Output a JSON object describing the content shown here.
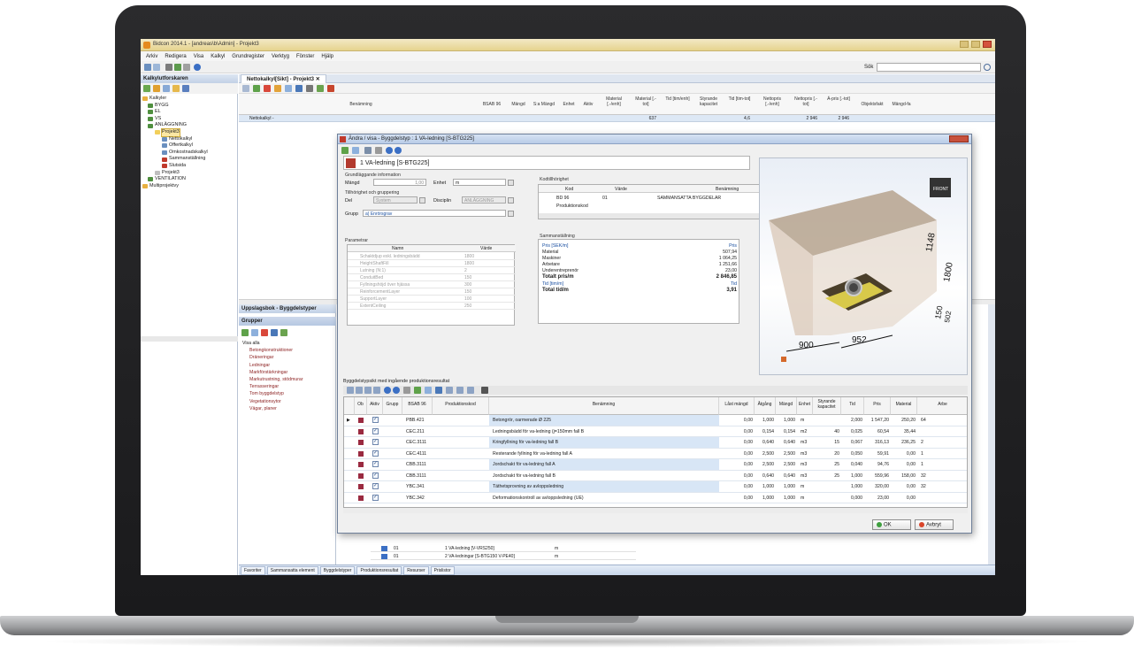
{
  "app": {
    "title": "Bidcon 2014.1 - [andreas\\b\\Admin] - Projekt3",
    "menu": [
      "Arkiv",
      "Redigera",
      "Visa",
      "Kalkyl",
      "Grundregister",
      "Verktyg",
      "Fönster",
      "Hjälp"
    ],
    "search_label": "Sök"
  },
  "left_panel": {
    "title": "Kalkylutforskaren",
    "tree": [
      {
        "label": "Kalkyler",
        "level": 0
      },
      {
        "label": "BYGG",
        "level": 1
      },
      {
        "label": "EL",
        "level": 1
      },
      {
        "label": "VS",
        "level": 1
      },
      {
        "label": "ANLÄGGNING",
        "level": 1
      },
      {
        "label": "Projekt3",
        "level": 2,
        "selected": true
      },
      {
        "label": "Nettokalkyl",
        "level": 3
      },
      {
        "label": "Offertkalkyl",
        "level": 3
      },
      {
        "label": "Omkostnadskalkyl",
        "level": 3
      },
      {
        "label": "Sammanställning",
        "level": 3
      },
      {
        "label": "Slutsida",
        "level": 3
      },
      {
        "label": "Projekt3",
        "level": 2
      },
      {
        "label": "VENTILATION",
        "level": 1
      },
      {
        "label": "Multiprojektvy",
        "level": 0
      }
    ]
  },
  "document": {
    "tab_label": "Nettokalkyl[Sikt] - Projekt3",
    "columns": [
      "Benämning",
      "BSAB 96",
      "Mängd",
      "S:a Mängd",
      "Enhet",
      "Aktiv",
      "Material [.-/enh]",
      "Material [.-tot]",
      "Tid [tim/enh]",
      "Styrande kapacitet",
      "Tid [tim-tot]",
      "Nettopris [.-/enh]",
      "Nettopris [.-tot]",
      "Á-pris [.-tot]",
      "Objektsfakt",
      "Mängd-fa"
    ],
    "row1": {
      "name": "Nettokalkyl -",
      "material_tot": "637",
      "tid_tot": "4,6",
      "netto_tot": "2 946",
      "apris_tot": "2 946"
    }
  },
  "lookup": {
    "title": "Uppslagsbok - Byggdelstyper",
    "groups_title": "Grupper",
    "groups": [
      {
        "label": "Visa alla",
        "level": 1
      },
      {
        "label": "Betongkonstruktioner",
        "level": 2
      },
      {
        "label": "Dräneringar",
        "level": 2
      },
      {
        "label": "Ledningar",
        "level": 2
      },
      {
        "label": "Markförstärkningar",
        "level": 2
      },
      {
        "label": "Markutrustning, stödmurar",
        "level": 2
      },
      {
        "label": "Terrasseringar",
        "level": 2
      },
      {
        "label": "Tom byggdelstyp",
        "level": 2
      },
      {
        "label": "Vegetationsytor",
        "level": 2
      },
      {
        "label": "Vägar, planer",
        "level": 2
      }
    ],
    "rows": [
      {
        "code": "01",
        "name": "1 VA-ledning [V-VRS250]",
        "unit": "m"
      },
      {
        "code": "01",
        "name": "2 VA-ledningar [S-BTG150 V-PE40]",
        "unit": "m"
      }
    ]
  },
  "statusbar": [
    "Favoriter",
    "Sammansatta element",
    "Byggdelstyper",
    "Produktionsresultat",
    "Resurser",
    "Prislistor"
  ],
  "dialog": {
    "title": "Ändra / visa - Byggdelstyp : 1 VA-ledning [S-BTG225]",
    "header": "1 VA-ledning [S-BTG225]",
    "grund_label": "Grundläggande information",
    "mangd_label": "Mängd",
    "mangd_value": "1,00",
    "enhet_label": "Enhet",
    "enhet_value": "m",
    "tillhor_label": "Tillhörighet och gruppering",
    "del_label": "Del",
    "del_value": "System",
    "disciplin_label": "Disciplin",
    "disciplin_value": "ANLÄGGNING",
    "grupp_label": "Grupp",
    "grupp_value": "a) Enrörsgrav",
    "param_label": "Parametrar",
    "param_headers": [
      "Namn",
      "Värde"
    ],
    "params": [
      {
        "name": "Schaktdjup exkl. ledningsbädd",
        "value": "1800"
      },
      {
        "name": "HeightShaftFill",
        "value": "1800"
      },
      {
        "name": "Lutning (N:1)",
        "value": "2"
      },
      {
        "name": "ConduitBed",
        "value": "150"
      },
      {
        "name": "Fyllningshöjd över hjässa",
        "value": "300"
      },
      {
        "name": "ReinforcementLayer",
        "value": "150"
      },
      {
        "name": "SupportLayer",
        "value": "100"
      },
      {
        "name": "ExtentCeiling",
        "value": "250"
      }
    ],
    "kod_label": "Kodtillhörighet",
    "kod_headers": [
      "Kod",
      "Värde",
      "Benämning"
    ],
    "kod_rows": [
      {
        "kod": "BD 96",
        "varde": "01",
        "ben": "SAMMANSATTA BYGGDELAR"
      },
      {
        "kod": "Produktionskod",
        "varde": "",
        "ben": ""
      }
    ],
    "summary_label": "Sammanställning",
    "summary_rows": [
      {
        "label": "Pris [SEK/m]",
        "value": "Pris",
        "style": "blue"
      },
      {
        "label": "Material",
        "value": "507,94",
        "style": ""
      },
      {
        "label": "Maskiner",
        "value": "1 064,25",
        "style": ""
      },
      {
        "label": "Arbetare",
        "value": "1 251,66",
        "style": ""
      },
      {
        "label": "Underentreprenör",
        "value": "23,00",
        "style": ""
      },
      {
        "label": "Totalt pris/m",
        "value": "2 846,85",
        "style": "bold"
      },
      {
        "label": "Tid [tim/m]",
        "value": "Tid",
        "style": "blue"
      },
      {
        "label": "Total tid/m",
        "value": "3,91",
        "style": "bold"
      }
    ],
    "dims": {
      "d1148": "1148",
      "d1800": "1800",
      "d150": "150",
      "d502": "502",
      "d900": "900",
      "d952": "952",
      "cube": "FRONT"
    },
    "pr_label": "Byggdelstypsikt med ingående produktionsresultat",
    "pr_headers": [
      "Ob",
      "Aktiv",
      "Grupp",
      "BSAB 96",
      "Produktionskod",
      "Benämning",
      "Låst mängd",
      "Åtgång",
      "Mängd",
      "Enhet",
      "Styrande kapacitet",
      "Tid",
      "Pris",
      "Material",
      "Arbe"
    ],
    "pr_rows": [
      {
        "bsab": "PBB.421",
        "ben": "Betongrör, oarmerade Ø 225",
        "last": "0,00",
        "atg": "1,000",
        "mangd": "1,000",
        "enhet": "m",
        "kap": "",
        "tid": "2,000",
        "pris": "1 547,20",
        "mat": "250,20",
        "arb": "64"
      },
      {
        "bsab": "CEC.211",
        "ben": "Ledningsbädd för va-ledning (j=150mm fall B",
        "last": "0,00",
        "atg": "0,154",
        "mangd": "0,154",
        "enhet": "m2",
        "kap": "40",
        "tid": "0,025",
        "pris": "60,54",
        "mat": "35,44",
        "arb": ""
      },
      {
        "bsab": "CEC.3111",
        "ben": "Kringfyllning för va-ledning fall B",
        "last": "0,00",
        "atg": "0,640",
        "mangd": "0,640",
        "enhet": "m3",
        "kap": "15",
        "tid": "0,067",
        "pris": "316,13",
        "mat": "236,25",
        "arb": "2"
      },
      {
        "bsab": "CEC.4111",
        "ben": "Resterande fyllning för va-ledning fall A",
        "last": "0,00",
        "atg": "2,500",
        "mangd": "2,500",
        "enhet": "m3",
        "kap": "20",
        "tid": "0,050",
        "pris": "59,91",
        "mat": "0,00",
        "arb": "1"
      },
      {
        "bsab": "CBB.3111",
        "ben": "Jordschakt för va-ledning fall A",
        "last": "0,00",
        "atg": "2,500",
        "mangd": "2,500",
        "enhet": "m3",
        "kap": "25",
        "tid": "0,040",
        "pris": "94,76",
        "mat": "0,00",
        "arb": "1"
      },
      {
        "bsab": "CBB.3111",
        "ben": "Jordschakt för va-ledning fall B",
        "last": "0,00",
        "atg": "0,640",
        "mangd": "0,640",
        "enhet": "m3",
        "kap": "25",
        "tid": "1,000",
        "pris": "559,96",
        "mat": "158,00",
        "arb": "32"
      },
      {
        "bsab": "YBC.341",
        "ben": "Täthetsprovning av avloppsledning",
        "last": "0,00",
        "atg": "1,000",
        "mangd": "1,000",
        "enhet": "m",
        "kap": "",
        "tid": "1,000",
        "pris": "320,00",
        "mat": "0,00",
        "arb": "32"
      },
      {
        "bsab": "YBC.342",
        "ben": "Deformationskontroll av avloppsledning (UE)",
        "last": "0,00",
        "atg": "1,000",
        "mangd": "1,000",
        "enhet": "m",
        "kap": "",
        "tid": "0,000",
        "pris": "23,00",
        "mat": "0,00",
        "arb": ""
      }
    ],
    "ok_label": "OK",
    "cancel_label": "Avbryt"
  }
}
